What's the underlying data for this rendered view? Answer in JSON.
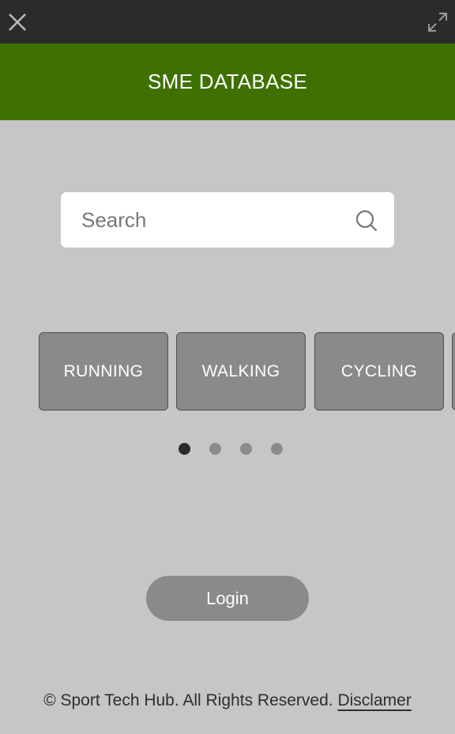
{
  "topbar": {
    "close_icon": "close-icon",
    "expand_icon": "expand-icon"
  },
  "header": {
    "title": "SME DATABASE",
    "color": "#3e7102"
  },
  "search": {
    "placeholder": "Search",
    "value": "",
    "icon": "search-icon"
  },
  "categories": [
    {
      "label": "RUNNING"
    },
    {
      "label": "WALKING"
    },
    {
      "label": "CYCLING"
    },
    {
      "label": ""
    }
  ],
  "carousel": {
    "page_count": 4,
    "active_page": 1
  },
  "login": {
    "label": "Login"
  },
  "footer": {
    "copyright": "© Sport Tech Hub. All Rights Reserved.",
    "disclaimer_link": "Disclamer"
  },
  "colors": {
    "topbar": "#2b2b2b",
    "background": "#c6c6c6",
    "tile": "#8a8a8a",
    "dot_active": "#2b2b2b"
  }
}
